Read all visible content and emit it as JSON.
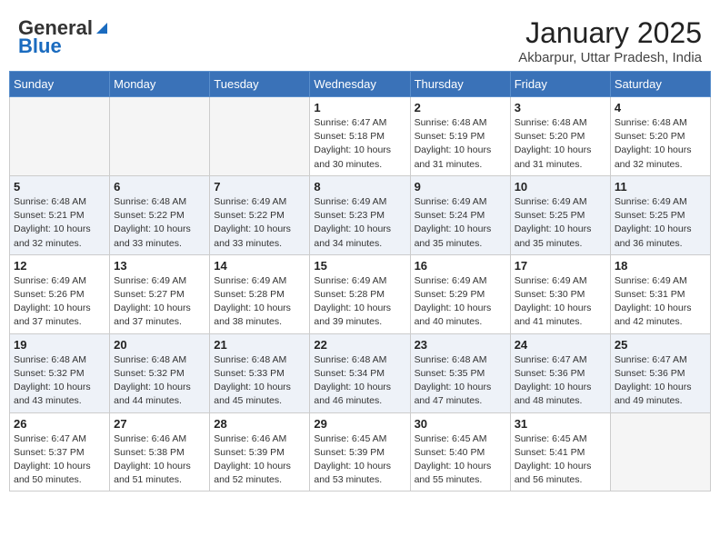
{
  "header": {
    "logo_line1": "General",
    "logo_line2": "Blue",
    "title": "January 2025",
    "subtitle": "Akbarpur, Uttar Pradesh, India"
  },
  "weekdays": [
    "Sunday",
    "Monday",
    "Tuesday",
    "Wednesday",
    "Thursday",
    "Friday",
    "Saturday"
  ],
  "weeks": [
    {
      "bg": "odd",
      "days": [
        {
          "num": "",
          "info": ""
        },
        {
          "num": "",
          "info": ""
        },
        {
          "num": "",
          "info": ""
        },
        {
          "num": "1",
          "info": "Sunrise: 6:47 AM\nSunset: 5:18 PM\nDaylight: 10 hours\nand 30 minutes."
        },
        {
          "num": "2",
          "info": "Sunrise: 6:48 AM\nSunset: 5:19 PM\nDaylight: 10 hours\nand 31 minutes."
        },
        {
          "num": "3",
          "info": "Sunrise: 6:48 AM\nSunset: 5:20 PM\nDaylight: 10 hours\nand 31 minutes."
        },
        {
          "num": "4",
          "info": "Sunrise: 6:48 AM\nSunset: 5:20 PM\nDaylight: 10 hours\nand 32 minutes."
        }
      ]
    },
    {
      "bg": "even",
      "days": [
        {
          "num": "5",
          "info": "Sunrise: 6:48 AM\nSunset: 5:21 PM\nDaylight: 10 hours\nand 32 minutes."
        },
        {
          "num": "6",
          "info": "Sunrise: 6:48 AM\nSunset: 5:22 PM\nDaylight: 10 hours\nand 33 minutes."
        },
        {
          "num": "7",
          "info": "Sunrise: 6:49 AM\nSunset: 5:22 PM\nDaylight: 10 hours\nand 33 minutes."
        },
        {
          "num": "8",
          "info": "Sunrise: 6:49 AM\nSunset: 5:23 PM\nDaylight: 10 hours\nand 34 minutes."
        },
        {
          "num": "9",
          "info": "Sunrise: 6:49 AM\nSunset: 5:24 PM\nDaylight: 10 hours\nand 35 minutes."
        },
        {
          "num": "10",
          "info": "Sunrise: 6:49 AM\nSunset: 5:25 PM\nDaylight: 10 hours\nand 35 minutes."
        },
        {
          "num": "11",
          "info": "Sunrise: 6:49 AM\nSunset: 5:25 PM\nDaylight: 10 hours\nand 36 minutes."
        }
      ]
    },
    {
      "bg": "odd",
      "days": [
        {
          "num": "12",
          "info": "Sunrise: 6:49 AM\nSunset: 5:26 PM\nDaylight: 10 hours\nand 37 minutes."
        },
        {
          "num": "13",
          "info": "Sunrise: 6:49 AM\nSunset: 5:27 PM\nDaylight: 10 hours\nand 37 minutes."
        },
        {
          "num": "14",
          "info": "Sunrise: 6:49 AM\nSunset: 5:28 PM\nDaylight: 10 hours\nand 38 minutes."
        },
        {
          "num": "15",
          "info": "Sunrise: 6:49 AM\nSunset: 5:28 PM\nDaylight: 10 hours\nand 39 minutes."
        },
        {
          "num": "16",
          "info": "Sunrise: 6:49 AM\nSunset: 5:29 PM\nDaylight: 10 hours\nand 40 minutes."
        },
        {
          "num": "17",
          "info": "Sunrise: 6:49 AM\nSunset: 5:30 PM\nDaylight: 10 hours\nand 41 minutes."
        },
        {
          "num": "18",
          "info": "Sunrise: 6:49 AM\nSunset: 5:31 PM\nDaylight: 10 hours\nand 42 minutes."
        }
      ]
    },
    {
      "bg": "even",
      "days": [
        {
          "num": "19",
          "info": "Sunrise: 6:48 AM\nSunset: 5:32 PM\nDaylight: 10 hours\nand 43 minutes."
        },
        {
          "num": "20",
          "info": "Sunrise: 6:48 AM\nSunset: 5:32 PM\nDaylight: 10 hours\nand 44 minutes."
        },
        {
          "num": "21",
          "info": "Sunrise: 6:48 AM\nSunset: 5:33 PM\nDaylight: 10 hours\nand 45 minutes."
        },
        {
          "num": "22",
          "info": "Sunrise: 6:48 AM\nSunset: 5:34 PM\nDaylight: 10 hours\nand 46 minutes."
        },
        {
          "num": "23",
          "info": "Sunrise: 6:48 AM\nSunset: 5:35 PM\nDaylight: 10 hours\nand 47 minutes."
        },
        {
          "num": "24",
          "info": "Sunrise: 6:47 AM\nSunset: 5:36 PM\nDaylight: 10 hours\nand 48 minutes."
        },
        {
          "num": "25",
          "info": "Sunrise: 6:47 AM\nSunset: 5:36 PM\nDaylight: 10 hours\nand 49 minutes."
        }
      ]
    },
    {
      "bg": "odd",
      "days": [
        {
          "num": "26",
          "info": "Sunrise: 6:47 AM\nSunset: 5:37 PM\nDaylight: 10 hours\nand 50 minutes."
        },
        {
          "num": "27",
          "info": "Sunrise: 6:46 AM\nSunset: 5:38 PM\nDaylight: 10 hours\nand 51 minutes."
        },
        {
          "num": "28",
          "info": "Sunrise: 6:46 AM\nSunset: 5:39 PM\nDaylight: 10 hours\nand 52 minutes."
        },
        {
          "num": "29",
          "info": "Sunrise: 6:45 AM\nSunset: 5:39 PM\nDaylight: 10 hours\nand 53 minutes."
        },
        {
          "num": "30",
          "info": "Sunrise: 6:45 AM\nSunset: 5:40 PM\nDaylight: 10 hours\nand 55 minutes."
        },
        {
          "num": "31",
          "info": "Sunrise: 6:45 AM\nSunset: 5:41 PM\nDaylight: 10 hours\nand 56 minutes."
        },
        {
          "num": "",
          "info": ""
        }
      ]
    }
  ]
}
